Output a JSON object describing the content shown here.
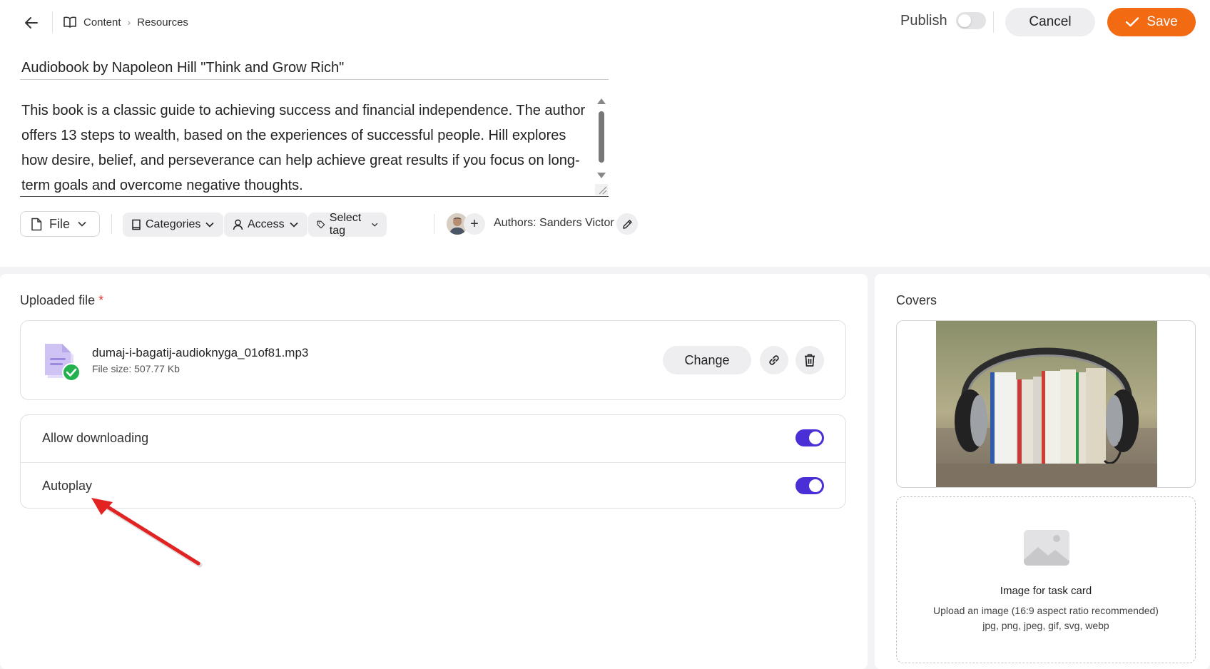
{
  "header": {
    "back_icon": "arrow-left-icon",
    "breadcrumb": [
      {
        "label": "Content",
        "icon": "book-open-icon"
      },
      {
        "label": "Resources"
      }
    ],
    "publish_label": "Publish",
    "publish_on": false,
    "cancel_label": "Cancel",
    "save_label": "Save"
  },
  "resource": {
    "title": "Audiobook by Napoleon Hill \"Think and Grow Rich\"",
    "description": "This book is a classic guide to achieving success and financial independence. The author offers 13 steps to wealth, based on the experiences of successful people. Hill explores how desire, belief, and perseverance can help achieve great results if you focus on long-term goals and overcome negative thoughts."
  },
  "toolbar": {
    "file_label": "File",
    "categories_label": "Categories",
    "access_label": "Access",
    "tag_label": "Select tag",
    "authors_text": "Authors: Sanders Victor"
  },
  "uploaded": {
    "section_title": "Uploaded file",
    "required_mark": "*",
    "file_name": "dumaj-i-bagatij-audioknyga_01of81.mp3",
    "file_size": "File size: 507.77 Kb",
    "change_label": "Change"
  },
  "options": [
    {
      "label": "Allow downloading",
      "enabled": true
    },
    {
      "label": "Autoplay",
      "enabled": true
    }
  ],
  "covers": {
    "section_title": "Covers",
    "image_subject": "books between headphones",
    "upload_title": "Image for task card",
    "upload_hint": "Upload an image (16:9 aspect ratio recommended)",
    "upload_formats": "jpg, png, jpeg, gif, svg, webp"
  },
  "colors": {
    "accent_orange": "#f26a12",
    "toggle_purple": "#4a2ed6",
    "annotation_red": "#e32222"
  }
}
